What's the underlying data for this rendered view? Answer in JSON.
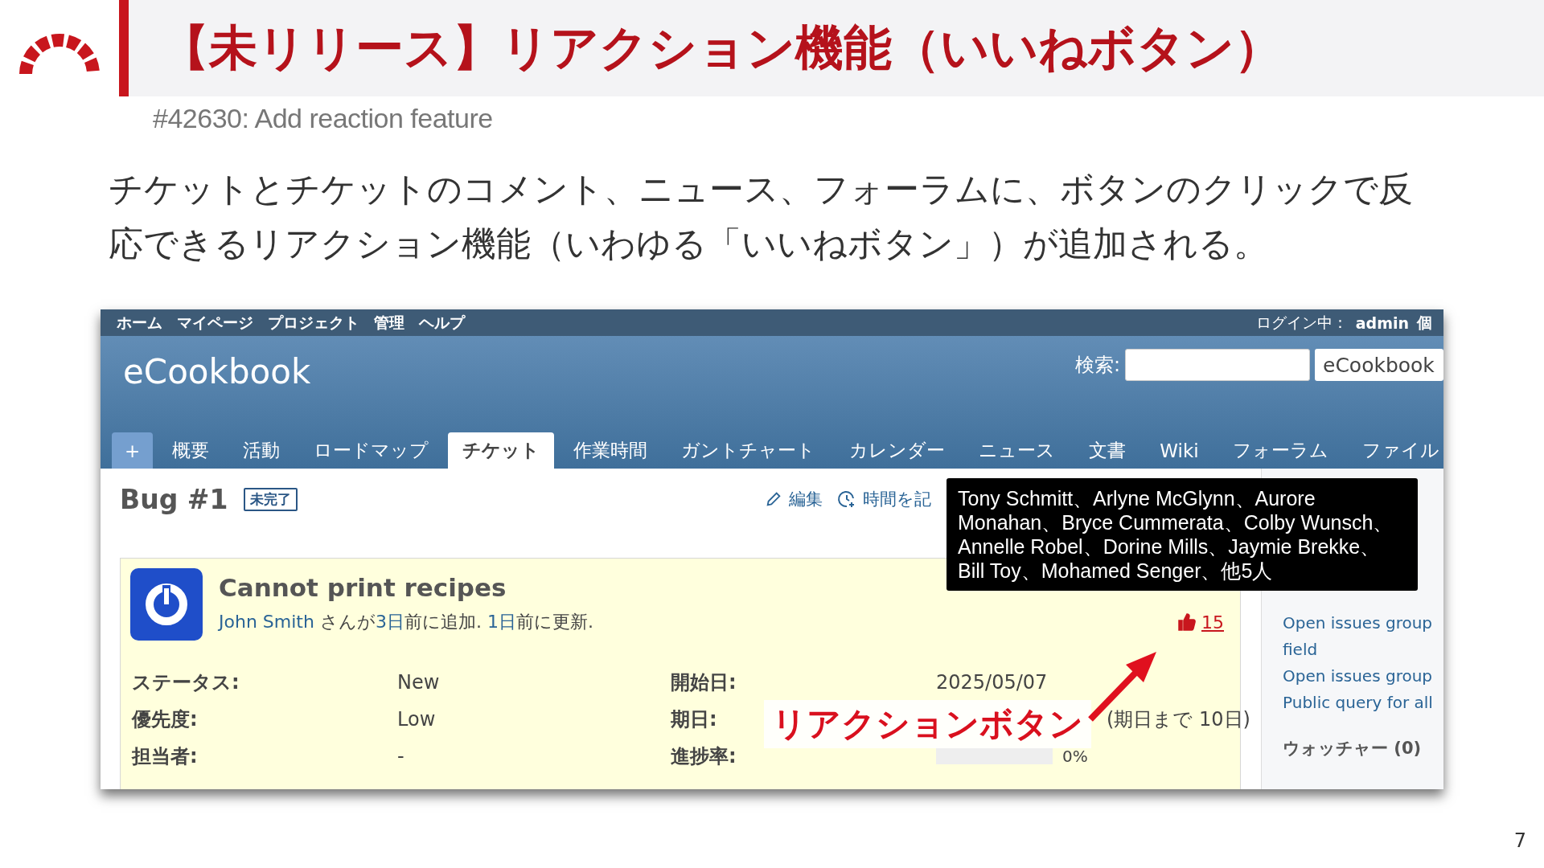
{
  "slide": {
    "title": "【未リリース】リアクション機能（いいねボタン）",
    "subtitle": "#42630: Add reaction feature",
    "body": "チケットとチケットのコメント、ニュース、フォーラムに、ボタンのクリックで反応できるリアクション機能（いわゆる「いいねボタン」）が追加される。",
    "page_number": "7"
  },
  "screenshot": {
    "top_menu": [
      "ホーム",
      "マイページ",
      "プロジェクト",
      "管理",
      "ヘルプ"
    ],
    "login_label": "ログイン中：",
    "login_user": "admin",
    "top_menu_cut": "個",
    "project_title": "eCookbook",
    "search_label": "検索:",
    "project_select": "eCookbook",
    "tabs": [
      {
        "label": "+",
        "kind": "add",
        "selected": false
      },
      {
        "label": "概要",
        "kind": "tab",
        "selected": false
      },
      {
        "label": "活動",
        "kind": "tab",
        "selected": false
      },
      {
        "label": "ロードマップ",
        "kind": "tab",
        "selected": false
      },
      {
        "label": "チケット",
        "kind": "tab",
        "selected": true
      },
      {
        "label": "作業時間",
        "kind": "tab",
        "selected": false
      },
      {
        "label": "ガントチャート",
        "kind": "tab",
        "selected": false
      },
      {
        "label": "カレンダー",
        "kind": "tab",
        "selected": false
      },
      {
        "label": "ニュース",
        "kind": "tab",
        "selected": false
      },
      {
        "label": "文書",
        "kind": "tab",
        "selected": false
      },
      {
        "label": "Wiki",
        "kind": "tab",
        "selected": false
      },
      {
        "label": "フォーラム",
        "kind": "tab",
        "selected": false
      },
      {
        "label": "ファイル",
        "kind": "tab",
        "selected": false
      }
    ],
    "issue": {
      "heading": "Bug #1",
      "status_badge": "未完了",
      "actions": [
        {
          "label": "編集",
          "kind": "edit"
        },
        {
          "label": "時間を記",
          "kind": "time"
        }
      ],
      "subject": "Cannot print recipes",
      "author": "John Smith",
      "added_text": " さんが",
      "added_ago": "3日",
      "added_suffix": "前に追加. ",
      "updated_ago": "1日",
      "updated_suffix": "前に更新.",
      "reaction": {
        "count": "15",
        "reacted": true
      },
      "attributes": [
        {
          "label": "ステータス:",
          "value": "New",
          "kind": "text"
        },
        {
          "label": "開始日:",
          "value": "2025/05/07",
          "kind": "text"
        },
        {
          "label": "優先度:",
          "value": "Low",
          "kind": "text"
        },
        {
          "label": "期日:",
          "value": "(期日まで 10日)",
          "kind": "text"
        },
        {
          "label": "担当者:",
          "value": "-",
          "kind": "text"
        },
        {
          "label": "進捗率:",
          "value": "0%",
          "kind": "progress",
          "level": 0
        }
      ]
    },
    "tooltip": "Tony Schmitt、Arlyne McGlynn、Aurore Monahan、Bryce Cummerata、Colby Wunsch、Annelle Robel、Dorine Mills、Jaymie Brekke、Bill Toy、Mohamed Senger、他5人",
    "sidebar": {
      "queries": [
        "Open issues group",
        "field",
        "Open issues group",
        "Public query for all"
      ],
      "watchers": "ウォッチャー (0)"
    },
    "annotation": "リアクションボタン"
  }
}
